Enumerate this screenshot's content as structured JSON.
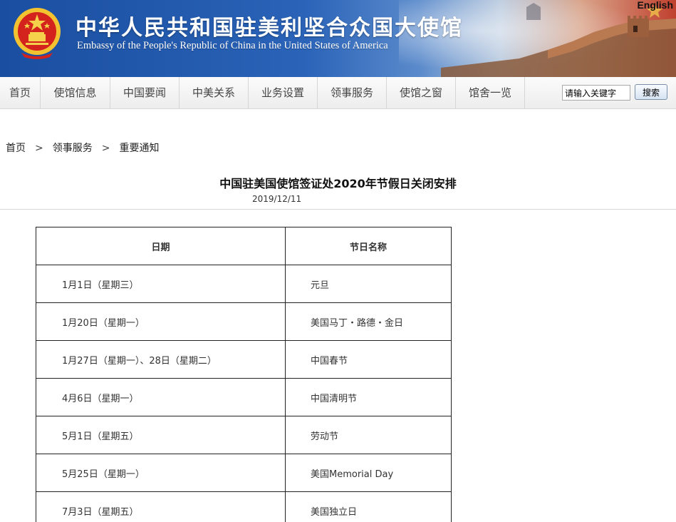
{
  "header": {
    "title_cn": "中华人民共和国驻美利坚合众国大使馆",
    "title_en": "Embassy of the People's Republic of China in the United States of America",
    "english_link": "English",
    "colors": {
      "banner_blue": "#2a63b8",
      "banner_red": "#c0402e"
    }
  },
  "nav": {
    "items": [
      {
        "label": "首页"
      },
      {
        "label": "使馆信息"
      },
      {
        "label": "中国要闻"
      },
      {
        "label": "中美关系"
      },
      {
        "label": "业务设置"
      },
      {
        "label": "领事服务"
      },
      {
        "label": "使馆之窗"
      },
      {
        "label": "馆舍一览"
      }
    ],
    "search": {
      "value": "请输入关键字",
      "button_label": "搜索"
    }
  },
  "breadcrumb": {
    "items": [
      {
        "label": "首页"
      },
      {
        "label": "领事服务"
      },
      {
        "label": "重要通知"
      }
    ],
    "separator": ">"
  },
  "article": {
    "title": "中国驻美国使馆签证处2020年节假日关闭安排",
    "date": "2019/12/11",
    "table": {
      "headers": [
        "日期",
        "节日名称"
      ],
      "rows": [
        [
          "1月1日（星期三）",
          "元旦"
        ],
        [
          "1月20日（星期一）",
          "美国马丁・路德・金日"
        ],
        [
          "1月27日（星期一）、28日（星期二）",
          "中国春节"
        ],
        [
          "4月6日（星期一）",
          "中国清明节"
        ],
        [
          "5月1日（星期五）",
          "劳动节"
        ],
        [
          "5月25日（星期一）",
          "美国Memorial Day"
        ],
        [
          "7月3日（星期五）",
          "美国独立日"
        ]
      ]
    }
  }
}
